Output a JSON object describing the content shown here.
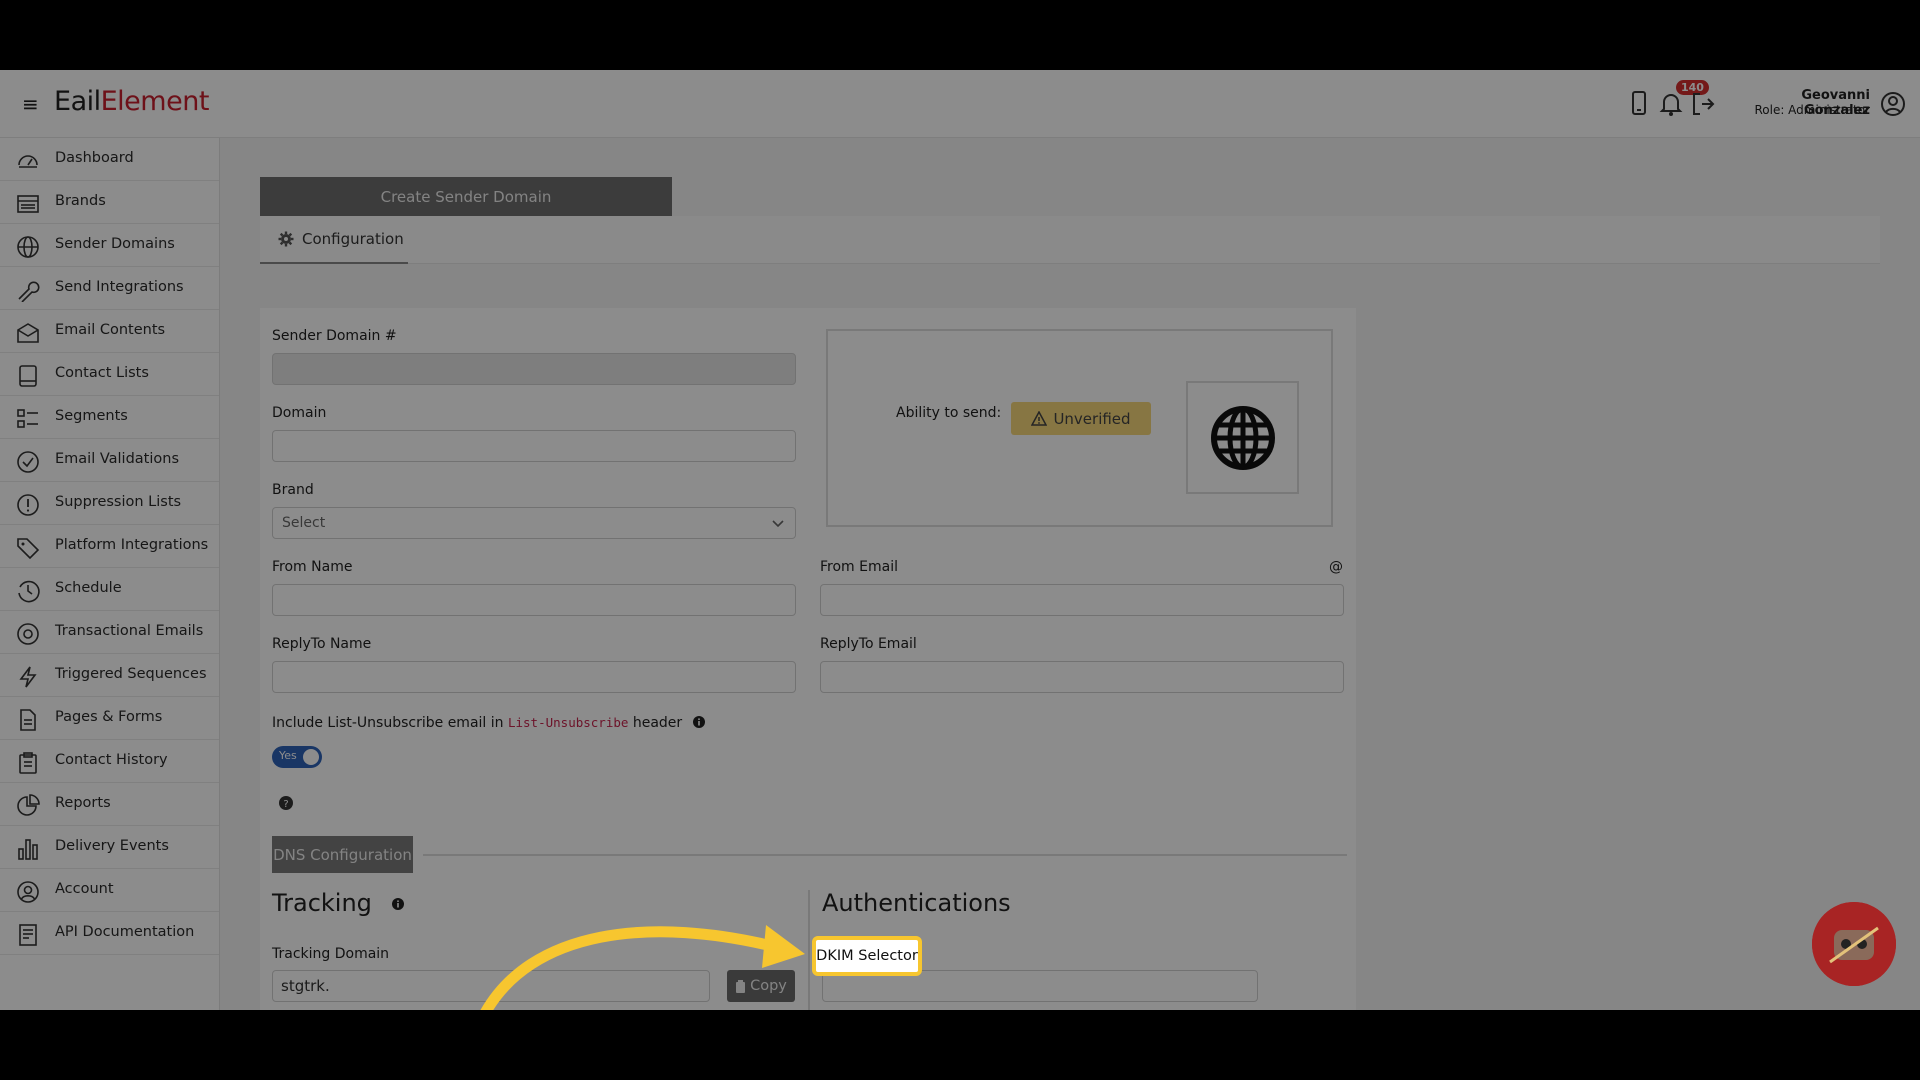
{
  "header": {
    "logo_prefix": "E",
    "logo_mid": "ail",
    "logo_accent": "Element",
    "notification_count": "140",
    "user_name": "Geovanni Gonzalez",
    "user_role": "Role: Administrator"
  },
  "sidebar": {
    "items": [
      {
        "label": "Dashboard",
        "icon": "dashboard-icon"
      },
      {
        "label": "Brands",
        "icon": "brands-icon"
      },
      {
        "label": "Sender Domains",
        "icon": "globe-icon"
      },
      {
        "label": "Send Integrations",
        "icon": "wrench-icon"
      },
      {
        "label": "Email Contents",
        "icon": "envelope-icon"
      },
      {
        "label": "Contact Lists",
        "icon": "book-icon"
      },
      {
        "label": "Segments",
        "icon": "segments-icon"
      },
      {
        "label": "Email Validations",
        "icon": "check-circle-icon"
      },
      {
        "label": "Suppression Lists",
        "icon": "exclamation-circle-icon"
      },
      {
        "label": "Platform Integrations",
        "icon": "tag-icon"
      },
      {
        "label": "Schedule",
        "icon": "clock-icon"
      },
      {
        "label": "Transactional Emails",
        "icon": "at-icon"
      },
      {
        "label": "Triggered Sequences",
        "icon": "lightning-icon"
      },
      {
        "label": "Pages & Forms",
        "icon": "file-icon"
      },
      {
        "label": "Contact History",
        "icon": "clipboard-icon"
      },
      {
        "label": "Reports",
        "icon": "pie-chart-icon"
      },
      {
        "label": "Delivery Events",
        "icon": "bar-chart-icon"
      },
      {
        "label": "Account",
        "icon": "user-circle-icon"
      },
      {
        "label": "API Documentation",
        "icon": "document-icon"
      }
    ]
  },
  "main": {
    "create_tab": "Create Sender Domain",
    "config_tab": "Configuration",
    "form": {
      "sender_domain_label": "Sender Domain #",
      "domain_label": "Domain",
      "brand_label": "Brand",
      "brand_placeholder": "Select",
      "from_name_label": "From Name",
      "from_email_label": "From Email",
      "at_symbol": "@",
      "replyto_name_label": "ReplyTo Name",
      "replyto_email_label": "ReplyTo Email",
      "unsubscribe_prefix": "Include List-Unsubscribe email in",
      "unsubscribe_code": "List-Unsubscribe",
      "unsubscribe_suffix": "header",
      "toggle_label": "Yes"
    },
    "status": {
      "ability_label": "Ability to send:",
      "badge": "Unverified"
    },
    "dns_tab": "DNS Configuration",
    "tracking_title": "Tracking",
    "tracking_domain_label": "Tracking Domain",
    "tracking_domain_value": "stgtrk.",
    "copy_button": "Copy",
    "auth_title": "Authentications",
    "dkim_label": "DKIM Selector"
  },
  "colors": {
    "brand_accent": "#c8202f",
    "toggle": "#2f63b8",
    "unverified_badge": "#f6d77a",
    "highlight": "#f7c62f"
  }
}
